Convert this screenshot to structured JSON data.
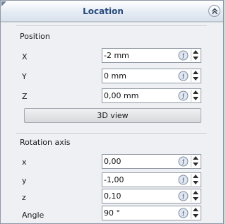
{
  "header": {
    "title": "Location"
  },
  "position": {
    "title": "Position",
    "x": {
      "label": "X",
      "value": "-2 mm"
    },
    "y": {
      "label": "Y",
      "value": "0 mm"
    },
    "z": {
      "label": "Z",
      "value": "0,00 mm"
    }
  },
  "view_button": {
    "label": "3D view"
  },
  "rotation": {
    "title": "Rotation axis",
    "x": {
      "label": "x",
      "value": "0,00"
    },
    "y": {
      "label": "y",
      "value": "-1,00"
    },
    "z": {
      "label": "z",
      "value": "0,10"
    },
    "angle": {
      "label": "Angle",
      "value": "90 °"
    }
  },
  "icons": {
    "collapse": "double-chevron-up-icon",
    "expression": "expression-icon",
    "spin_up": "arrow-up-icon",
    "spin_down": "arrow-down-icon"
  },
  "colors": {
    "title": "#254a7c",
    "panel_bg": "#eef0f3"
  }
}
